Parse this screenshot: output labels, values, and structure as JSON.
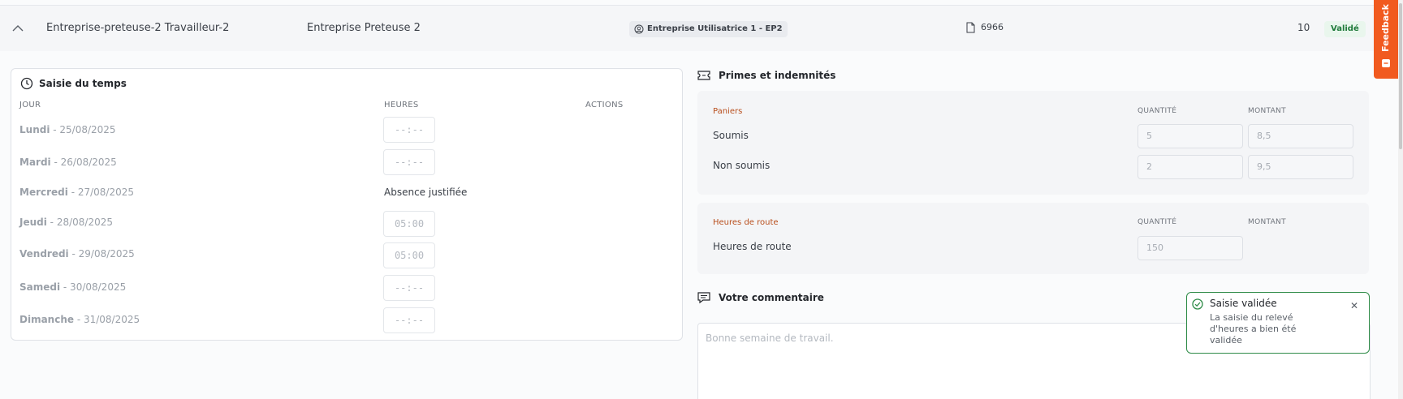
{
  "row": {
    "worker": "Entreprise-preteuse-2 Travailleur-2",
    "company": "Entreprise Preteuse 2",
    "client_badge": "Entreprise Utilisatrice 1 - EP2",
    "doc_number": "6966",
    "count": "10",
    "status": "Validé",
    "status_color": "#1f7a3a"
  },
  "time_entry": {
    "title": "Saisie du temps",
    "col_day": "JOUR",
    "col_hours": "HEURES",
    "col_actions": "ACTIONS",
    "days": [
      {
        "day": "Lundi",
        "date": " - 25/08/2025",
        "hours": "--:--"
      },
      {
        "day": "Mardi",
        "date": " - 26/08/2025",
        "hours": "--:--"
      },
      {
        "day": "Mercredi",
        "date": " - 27/08/2025",
        "absence": "Absence justifiée"
      },
      {
        "day": "Jeudi",
        "date": " - 28/08/2025",
        "hours": "05:00"
      },
      {
        "day": "Vendredi",
        "date": " - 29/08/2025",
        "hours": "05:00"
      },
      {
        "day": "Samedi",
        "date": " - 30/08/2025",
        "hours": "--:--"
      },
      {
        "day": "Dimanche",
        "date": " - 31/08/2025",
        "hours": "--:--"
      }
    ]
  },
  "bonuses": {
    "title": "Primes et indemnités",
    "paniers": {
      "label": "Paniers",
      "col_qty": "QUANTITÉ",
      "col_amount": "MONTANT",
      "rows": [
        {
          "label": "Soumis",
          "qty": "5",
          "amount": "8,5"
        },
        {
          "label": "Non soumis",
          "qty": "2",
          "amount": "9,5"
        }
      ]
    },
    "route": {
      "label": "Heures de route",
      "col_qty": "QUANTITÉ",
      "col_amount": "MONTANT",
      "rows": [
        {
          "label": "Heures de route",
          "qty": "150"
        }
      ]
    }
  },
  "comment": {
    "title": "Votre commentaire",
    "placeholder": "Bonne semaine de travail."
  },
  "toast": {
    "title": "Saisie validée",
    "message": "La saisie du relevé d'heures a bien été validée",
    "accent": "#2e8b47"
  },
  "feedback": {
    "label": "Feedback",
    "color": "#f15a1f"
  }
}
